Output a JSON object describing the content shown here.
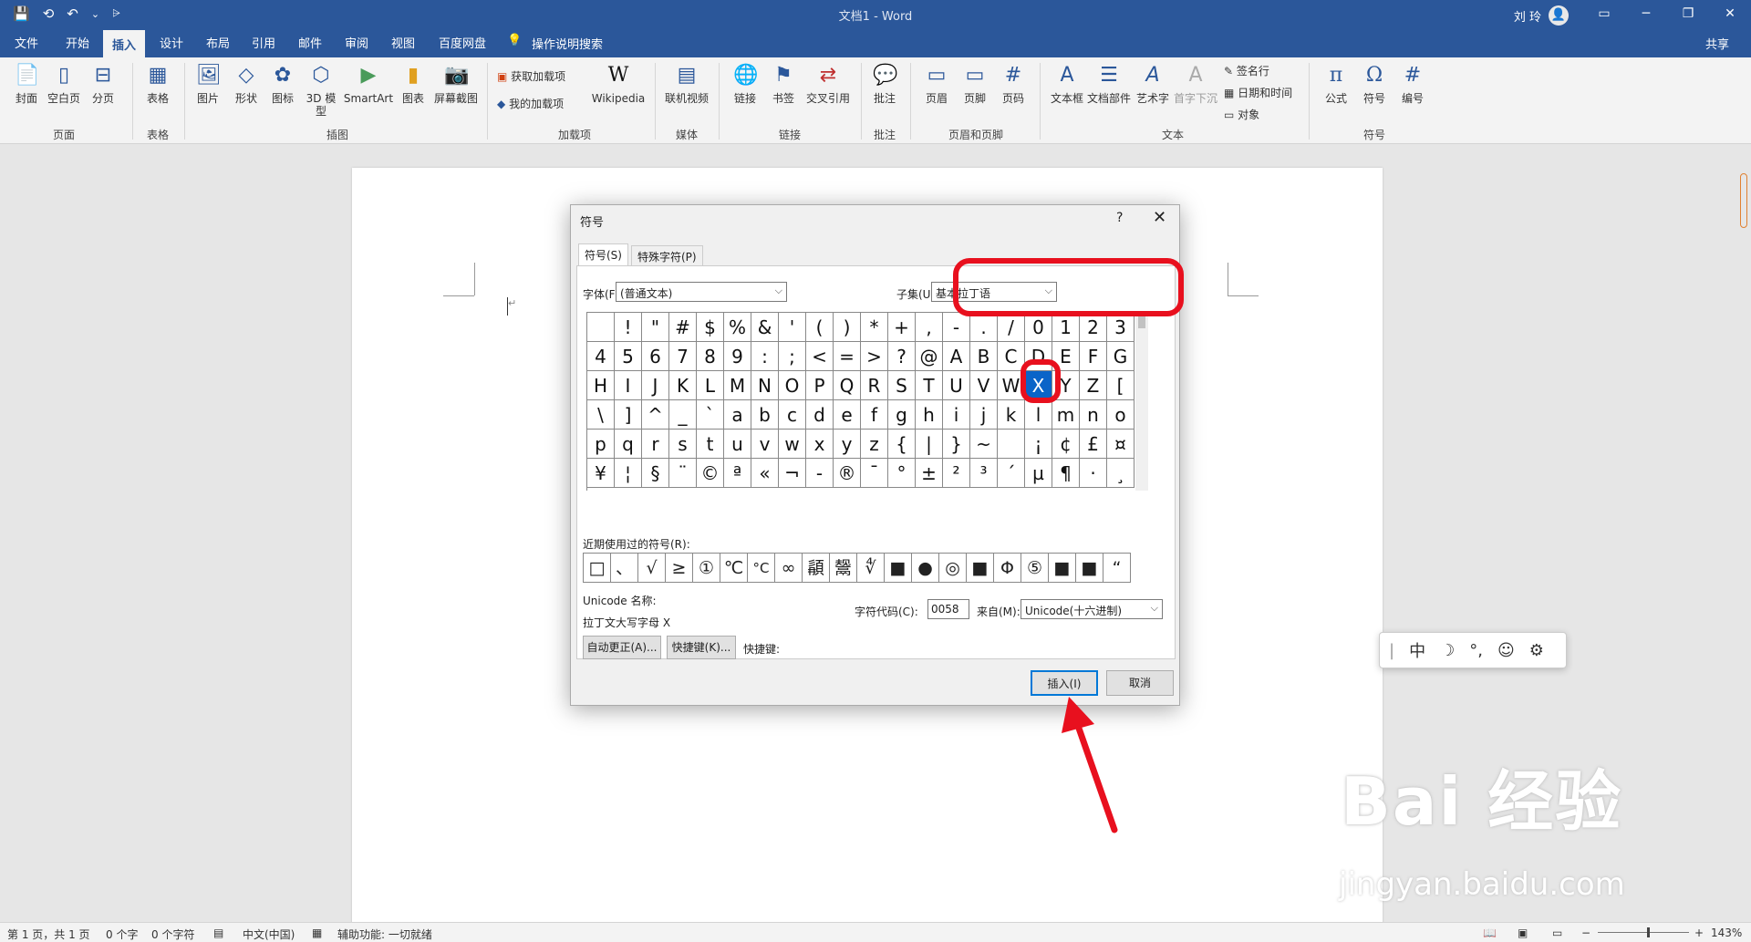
{
  "titlebar": {
    "doc_title": "文档1 - Word",
    "user": "刘 玲",
    "avatar": "👤",
    "save_icon": "💾",
    "redo_icon": "⟲",
    "undo_icon": "↶",
    "undo_more": "⌄",
    "customize": "⩥",
    "ribbon_toggle": "▭",
    "minimize": "─",
    "restore": "❐",
    "close": "✕"
  },
  "tabs": {
    "file": "文件",
    "home": "开始",
    "insert": "插入",
    "design": "设计",
    "layout": "布局",
    "references": "引用",
    "mailings": "邮件",
    "review": "审阅",
    "view": "视图",
    "baidu": "百度网盘",
    "tell_me": "操作说明搜索",
    "share": "共享"
  },
  "ribbon": {
    "cover": "封面",
    "blank": "空白页",
    "break": "分页",
    "group_pages": "页面",
    "table": "表格",
    "group_table": "表格",
    "picture": "图片",
    "shapes": "形状",
    "icons": "图标",
    "model": "3D 模型",
    "smartart": "SmartArt",
    "chart": "图表",
    "screenshot": "屏幕截图",
    "group_illus": "插图",
    "get_addins": "获取加载项",
    "my_addins": "我的加载项",
    "wikipedia": "Wikipedia",
    "group_addins": "加载项",
    "online_video": "联机视频",
    "group_media": "媒体",
    "link": "链接",
    "bookmark": "书签",
    "crossref": "交叉引用",
    "group_links": "链接",
    "comment": "批注",
    "group_comments": "批注",
    "header": "页眉",
    "footer": "页脚",
    "pagenum": "页码",
    "group_hf": "页眉和页脚",
    "textbox": "文本框",
    "quickparts": "文档部件",
    "wordart": "艺术字",
    "dropcap": "首字下沉",
    "sigline": "签名行",
    "datetime": "日期和时间",
    "object": "对象",
    "group_text": "文本",
    "equation": "公式",
    "symbol": "符号",
    "number": "编号",
    "group_symbols": "符号"
  },
  "dialog": {
    "title": "符号",
    "help": "?",
    "close": "✕",
    "tab_symbols": "符号(S)",
    "tab_special": "特殊字符(P)",
    "font_label": "字体(F):",
    "font_value": "(普通文本)",
    "subset_label": "子集(U):",
    "subset_value": "基本拉丁语",
    "grid": [
      [
        " ",
        "!",
        "\"",
        "#",
        "$",
        "%",
        "&",
        "'",
        "(",
        ")",
        "*",
        "+",
        ",",
        "-",
        ".",
        "/",
        "0",
        "1",
        "2",
        "3"
      ],
      [
        "4",
        "5",
        "6",
        "7",
        "8",
        "9",
        ":",
        ";",
        "<",
        "=",
        ">",
        "?",
        "@",
        "A",
        "B",
        "C",
        "D",
        "E",
        "F",
        "G"
      ],
      [
        "H",
        "I",
        "J",
        "K",
        "L",
        "M",
        "N",
        "O",
        "P",
        "Q",
        "R",
        "S",
        "T",
        "U",
        "V",
        "W",
        "X",
        "Y",
        "Z",
        "["
      ],
      [
        "\\",
        "]",
        "^",
        "_",
        "`",
        "a",
        "b",
        "c",
        "d",
        "e",
        "f",
        "g",
        "h",
        "i",
        "j",
        "k",
        "l",
        "m",
        "n",
        "o"
      ],
      [
        "p",
        "q",
        "r",
        "s",
        "t",
        "u",
        "v",
        "w",
        "x",
        "y",
        "z",
        "{",
        "|",
        "}",
        "~",
        " ",
        "¡",
        "¢",
        "£",
        "¤"
      ],
      [
        "¥",
        "¦",
        "§",
        "¨",
        "©",
        "ª",
        "«",
        "¬",
        "-",
        "®",
        "¯",
        "°",
        "±",
        "²",
        "³",
        "´",
        "µ",
        "¶",
        "·",
        "¸"
      ]
    ],
    "selected": "X",
    "recent_label": "近期使用过的符号(R):",
    "recent": [
      "□",
      "、",
      "√",
      "≥",
      "①",
      "℃",
      "°C",
      "∞",
      "䫇",
      "鬶",
      "∜",
      "■",
      "●",
      "◎",
      "■",
      "Φ",
      "⑤",
      "■",
      "■",
      "“"
    ],
    "unicode_name_label": "Unicode 名称:",
    "unicode_name": "拉丁文大写字母 X",
    "charcode_label": "字符代码(C):",
    "charcode": "0058",
    "from_label": "来自(M):",
    "from_value": "Unicode(十六进制)",
    "autocorrect": "自动更正(A)...",
    "shortcut_key_btn": "快捷键(K)...",
    "shortcut_label": "快捷键:",
    "insert": "插入(I)",
    "cancel": "取消"
  },
  "ime": {
    "sep": "|",
    "lang": "中",
    "moon": "☽",
    "punct": "°,",
    "emoji": "☺",
    "settings": "⚙"
  },
  "status": {
    "page": "第 1 页，共 1 页",
    "words": "0 个字",
    "chars": "0 个字符",
    "lang": "中文(中国)",
    "accessibility": "辅助功能: 一切就绪",
    "zoom": "143%",
    "zoom_minus": "−",
    "zoom_plus": "+"
  },
  "watermark": {
    "brand": "Bai 经验",
    "url": "jingyan.baidu.com"
  }
}
